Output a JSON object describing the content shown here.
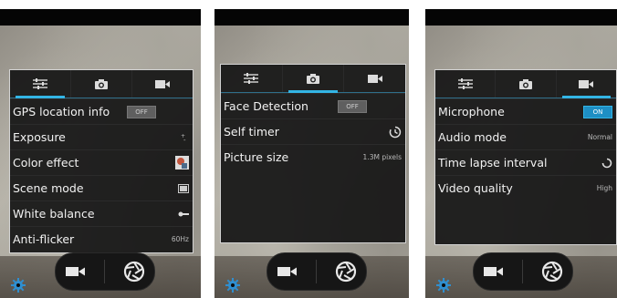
{
  "screens": [
    {
      "active_tab": 0,
      "rows": [
        {
          "label": "GPS location info",
          "value": "OFF",
          "kind": "switch"
        },
        {
          "label": "Exposure",
          "value": "",
          "kind": "icon",
          "icon": "exposure-icon"
        },
        {
          "label": "Color effect",
          "value": "",
          "kind": "icon",
          "icon": "color-effect-thumbnail-icon"
        },
        {
          "label": "Scene mode",
          "value": "",
          "kind": "icon",
          "icon": "scene-mode-icon"
        },
        {
          "label": "White balance",
          "value": "",
          "kind": "icon",
          "icon": "white-balance-icon"
        },
        {
          "label": "Anti-flicker",
          "value": "60Hz",
          "kind": "text"
        }
      ],
      "show_gear": true
    },
    {
      "active_tab": 1,
      "rows": [
        {
          "label": "Face Detection",
          "value": "OFF",
          "kind": "switch"
        },
        {
          "label": "Self timer",
          "value": "",
          "kind": "icon",
          "icon": "timer-icon"
        },
        {
          "label": "Picture size",
          "value": "1.3M pixels",
          "kind": "text"
        }
      ],
      "show_gear": false
    },
    {
      "active_tab": 2,
      "rows": [
        {
          "label": "Microphone",
          "value": "ON",
          "kind": "switch-on"
        },
        {
          "label": "Audio mode",
          "value": "Normal",
          "kind": "text"
        },
        {
          "label": "Time lapse interval",
          "value": "",
          "kind": "icon",
          "icon": "time-lapse-icon"
        },
        {
          "label": "Video quality",
          "value": "High",
          "kind": "text"
        }
      ],
      "show_gear": true
    }
  ],
  "tabs": [
    {
      "icon": "general-settings-sliders-icon"
    },
    {
      "icon": "camera-tab-icon"
    },
    {
      "icon": "video-tab-icon"
    }
  ],
  "controls": {
    "video_icon": "video-camera-icon",
    "shutter_icon": "shutter-icon",
    "gear_icon": "settings-gear-icon"
  },
  "colors": {
    "accent": "#33b5e5"
  }
}
